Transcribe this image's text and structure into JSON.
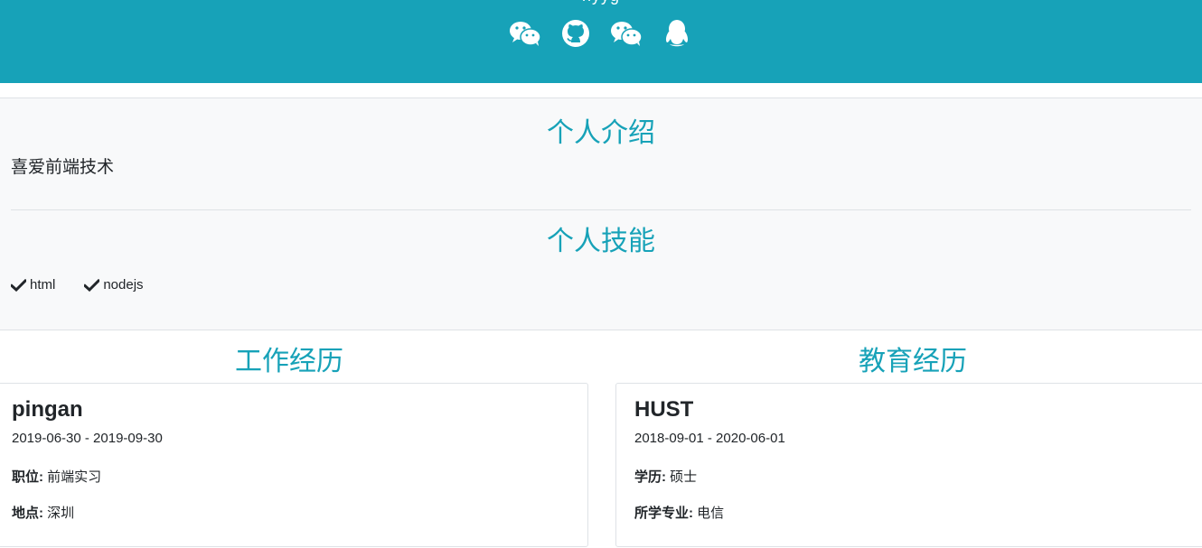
{
  "header": {
    "title_fragment": "nyyg",
    "icons": [
      "wechat-icon",
      "github-icon",
      "wechat-icon",
      "qq-icon"
    ],
    "background_color": "#17a2b8"
  },
  "intro": {
    "title": "个人介绍",
    "text": "喜爱前端技术"
  },
  "skills": {
    "title": "个人技能",
    "items": [
      "html",
      "nodejs"
    ]
  },
  "work": {
    "title": "工作经历",
    "org": "pingan",
    "date": "2019-06-30 - 2019-09-30",
    "position_label": "职位:",
    "position": "前端实习",
    "location_label": "地点:",
    "location": "深圳"
  },
  "education": {
    "title": "教育经历",
    "org": "HUST",
    "date": "2018-09-01 - 2020-06-01",
    "degree_label": "学历:",
    "degree": "硕士",
    "major_label": "所学专业:",
    "major": "电信"
  },
  "colors": {
    "accent": "#17a2b8",
    "band": "#f8f9fa"
  }
}
